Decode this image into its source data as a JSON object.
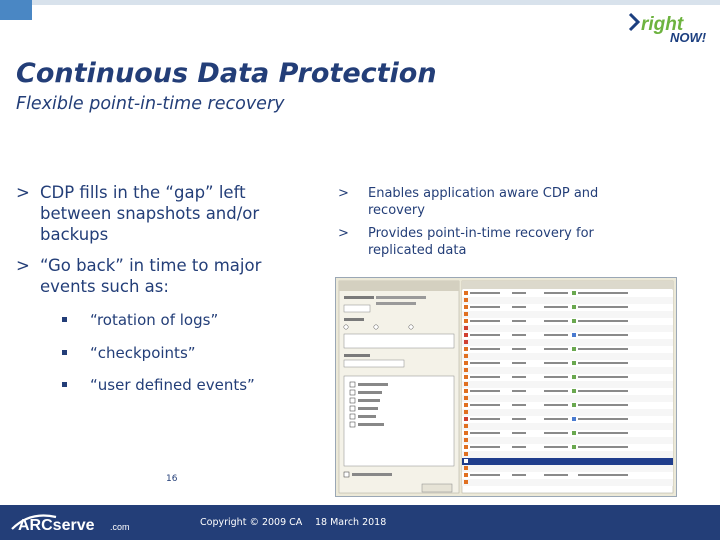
{
  "logo": {
    "right_brand": "right",
    "now_brand": "NOW!",
    "arc_brand": "ARCserve",
    "arc_suffix": ".com"
  },
  "slide": {
    "title": "Continuous Data Protection",
    "subtitle": "Flexible point-in-time recovery"
  },
  "left_bullets": [
    {
      "marker": ">",
      "lines": [
        "CDP fills in the “gap” left",
        "between snapshots and/or",
        "backups"
      ]
    },
    {
      "marker": ">",
      "lines": [
        "“Go back” in time to major",
        "events such as:"
      ]
    }
  ],
  "sub_bullets": [
    "“rotation of logs”",
    "“checkpoints”",
    "“user defined events”"
  ],
  "right_bullets": [
    {
      "marker": ">",
      "lines": [
        "Enables application aware CDP and",
        "recovery"
      ]
    },
    {
      "marker": ">",
      "lines": [
        "Provides point-in-time recovery for",
        "replicated data"
      ]
    }
  ],
  "footer": {
    "page_number": "16",
    "copyright": "Copyright © 2009 CA",
    "date": "18 March 2018"
  },
  "colors": {
    "title_blue": "#233e78",
    "footer_navy": "#233e78",
    "rn_green": "#6db33f",
    "rn_blue": "#1c3f80"
  }
}
